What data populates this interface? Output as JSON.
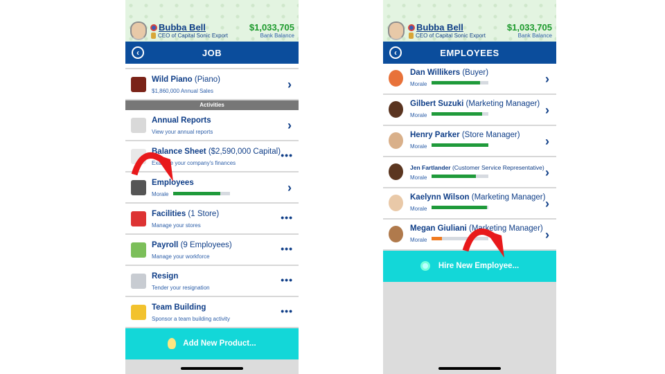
{
  "user": {
    "name": "Bubba Bell",
    "title": "CEO of Capital Sonic Export",
    "balance": "$1,033,705",
    "balance_label": "Bank Balance"
  },
  "left": {
    "nav_title": "JOB",
    "product": {
      "name": "Wild Piano",
      "type": "(Piano)",
      "sub": "$1,860,000 Annual Sales"
    },
    "section": "Activities",
    "rows": [
      {
        "title": "Annual Reports",
        "extra": "",
        "sub": "View your annual reports",
        "action": "chevron"
      },
      {
        "title": "Balance Sheet",
        "extra": "($2,590,000 Capital)",
        "sub": "Examine your company's finances",
        "action": "more"
      },
      {
        "title": "Employees",
        "extra": "",
        "sub": "Morale",
        "morale": 0.83,
        "action": "chevron"
      },
      {
        "title": "Facilities",
        "extra": "(1 Store)",
        "sub": "Manage your stores",
        "action": "more"
      },
      {
        "title": "Payroll",
        "extra": "(9 Employees)",
        "sub": "Manage your workforce",
        "action": "more"
      },
      {
        "title": "Resign",
        "extra": "",
        "sub": "Tender your resignation",
        "action": "more"
      },
      {
        "title": "Team Building",
        "extra": "",
        "sub": "Sponsor a team building activity",
        "action": "more"
      }
    ],
    "cta": "Add New Product..."
  },
  "right": {
    "nav_title": "EMPLOYEES",
    "morale_label": "Morale",
    "employees": [
      {
        "name": "Dan Willikers",
        "role": "(Buyer)",
        "morale": 0.85,
        "color": "#1f9a3a"
      },
      {
        "name": "Gilbert Suzuki",
        "role": "(Marketing Manager)",
        "morale": 0.89,
        "color": "#1f9a3a"
      },
      {
        "name": "Henry Parker",
        "role": "(Store Manager)",
        "morale": 1.0,
        "color": "#1f9a3a"
      },
      {
        "name": "Jen Fartlander",
        "role": "(Customer Service Representative)",
        "morale": 0.78,
        "color": "#1f9a3a"
      },
      {
        "name": "Kaelynn Wilson",
        "role": "(Marketing Manager)",
        "morale": 0.97,
        "color": "#1f9a3a"
      },
      {
        "name": "Megan Giuliani",
        "role": "(Marketing Manager)",
        "morale": 0.18,
        "color": "#f07a1f"
      }
    ],
    "cta": "Hire New Employee..."
  },
  "icons": {
    "back": "‹",
    "chevron": "›",
    "more": "•••"
  }
}
